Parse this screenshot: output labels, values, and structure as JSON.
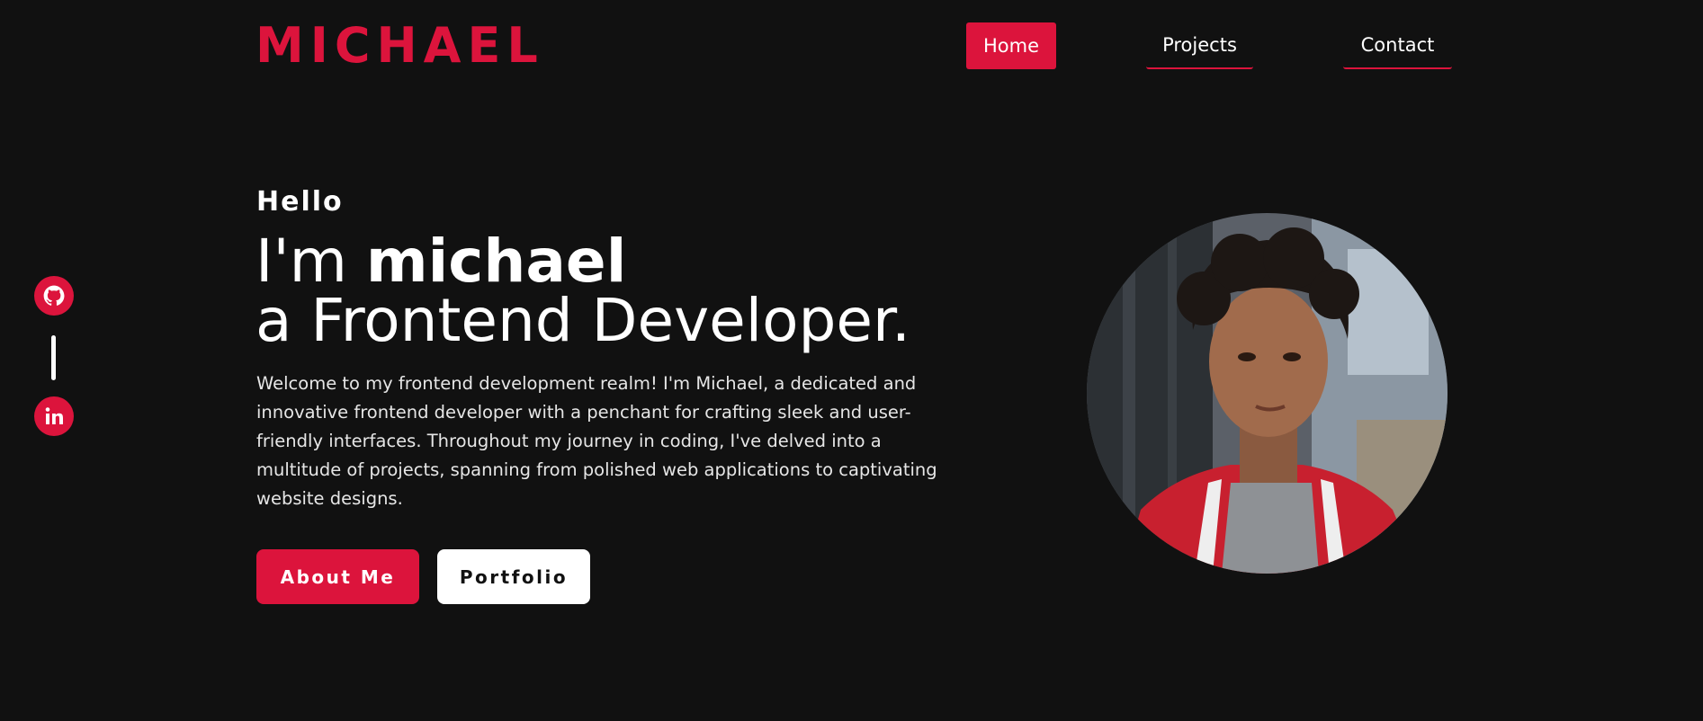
{
  "header": {
    "logo": "MICHAEL",
    "nav": [
      {
        "label": "Home",
        "active": true
      },
      {
        "label": "Projects",
        "active": false
      },
      {
        "label": "Contact",
        "active": false
      }
    ]
  },
  "social": [
    {
      "icon": "github-icon"
    },
    {
      "icon": "linkedin-icon"
    }
  ],
  "hero": {
    "greeting": "Hello",
    "headline_prefix": "I'm ",
    "name": "michael",
    "headline_line2": "a Frontend Developer.",
    "intro": "Welcome to my frontend development realm! I'm Michael, a dedicated and innovative frontend developer with a penchant for crafting sleek and user-friendly interfaces. Throughout my journey in coding, I've delved into a multitude of projects, spanning from polished web applications to captivating website designs.",
    "buttons": {
      "about": "About Me",
      "portfolio": "Portfolio"
    }
  },
  "colors": {
    "accent": "#dc143c",
    "background": "#111111",
    "text": "#ffffff"
  }
}
